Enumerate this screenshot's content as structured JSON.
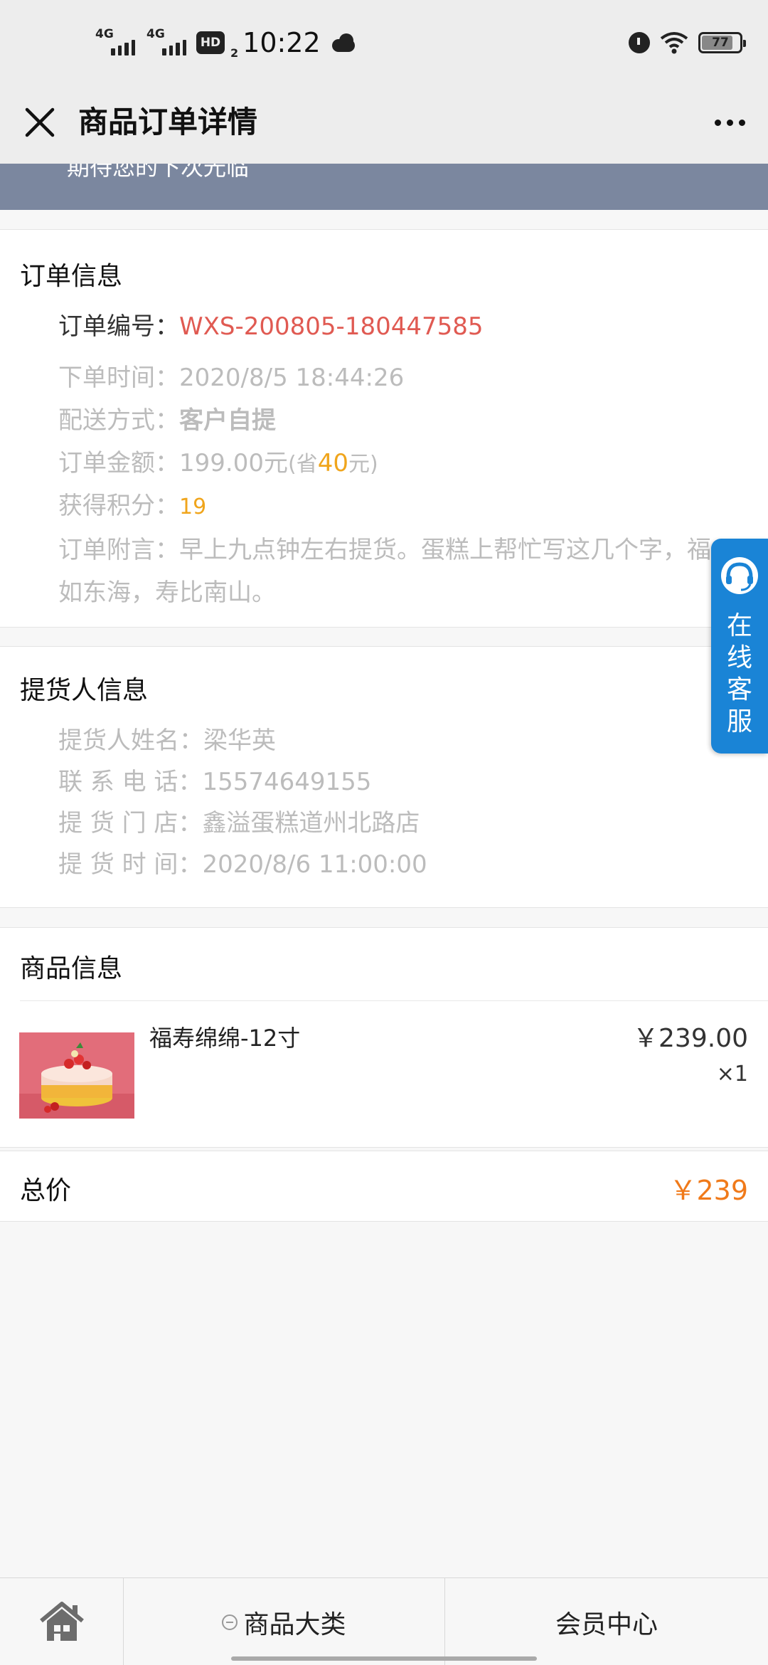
{
  "status_bar": {
    "signal1": "4G",
    "signal2": "4G",
    "hd": "HD",
    "hd_sub": "2",
    "time": "10:22",
    "battery": "77"
  },
  "nav": {
    "title": "商品订单详情"
  },
  "banner": {
    "text": "期待您的下次光临"
  },
  "order_info": {
    "title": "订单信息",
    "order_no_label": "订单编号：",
    "order_no": "WXS-200805-180447585",
    "time_label": "下单时间：",
    "time": "2020/8/5 18:44:26",
    "delivery_label": "配送方式：",
    "delivery": "客户自提",
    "amount_label": "订单金额：",
    "amount": "199.00元",
    "save_prefix": "(省",
    "save_amount": "40",
    "save_suffix": "元)",
    "points_label": "获得积分：",
    "points": "19",
    "note_label": "订单附言：",
    "note": "早上九点钟左右提货。蛋糕上帮忙写这几个字，福如东海，寿比南山。"
  },
  "pickup_info": {
    "title": "提货人信息",
    "name_label": "提货人姓名：",
    "name": "梁华英",
    "phone_label": "联 系 电 话：",
    "phone": "15574649155",
    "store_label": "提 货 门 店：",
    "store": "鑫溢蛋糕道州北路店",
    "time_label": "提 货 时 间：",
    "time": "2020/8/6 11:00:00"
  },
  "product_info": {
    "title": "商品信息",
    "items": [
      {
        "name": "福寿绵绵-12寸",
        "price": "￥239.00",
        "qty": "×1"
      }
    ]
  },
  "total": {
    "label": "总价",
    "value": "￥239"
  },
  "service": {
    "label": "在线客服"
  },
  "tab_bar": {
    "category": "商品大类",
    "member": "会员中心"
  },
  "colors": {
    "order_no": "#e05a52",
    "highlight": "#f0a51c",
    "total": "#f07a1a",
    "service_bg": "#1a84d6",
    "banner_bg": "#7b879f"
  }
}
